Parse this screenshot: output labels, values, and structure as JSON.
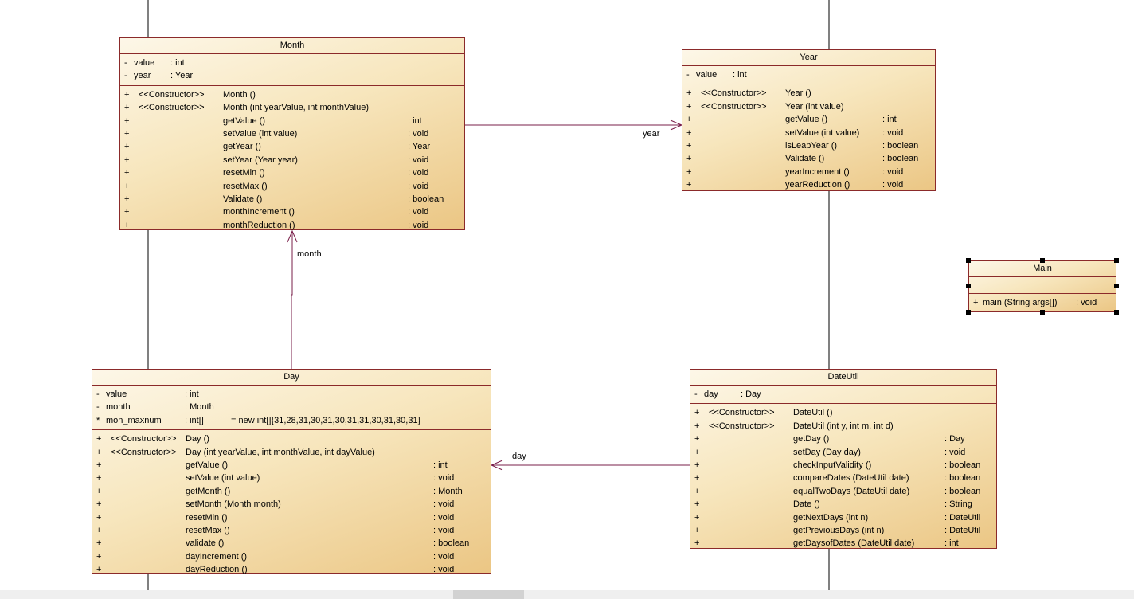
{
  "classes": {
    "month": {
      "name": "Month",
      "attributes": [
        {
          "vis": "-",
          "name": "value",
          "type": ": int",
          "init": ""
        },
        {
          "vis": "-",
          "name": "year",
          "type": ": Year",
          "init": ""
        }
      ],
      "operations": [
        {
          "vis": "+",
          "stereo": "<<Constructor>>",
          "sig": "Month ()",
          "ret": ""
        },
        {
          "vis": "+",
          "stereo": "<<Constructor>>",
          "sig": "Month (int yearValue, int monthValue)",
          "ret": ""
        },
        {
          "vis": "+",
          "stereo": "",
          "sig": "getValue ()",
          "ret": ": int"
        },
        {
          "vis": "+",
          "stereo": "",
          "sig": "setValue (int value)",
          "ret": ": void"
        },
        {
          "vis": "+",
          "stereo": "",
          "sig": "getYear ()",
          "ret": ": Year"
        },
        {
          "vis": "+",
          "stereo": "",
          "sig": "setYear (Year year)",
          "ret": ": void"
        },
        {
          "vis": "+",
          "stereo": "",
          "sig": "resetMin ()",
          "ret": ": void"
        },
        {
          "vis": "+",
          "stereo": "",
          "sig": "resetMax ()",
          "ret": ": void"
        },
        {
          "vis": "+",
          "stereo": "",
          "sig": "Validate ()",
          "ret": ": boolean"
        },
        {
          "vis": "+",
          "stereo": "",
          "sig": "monthIncrement ()",
          "ret": ": void"
        },
        {
          "vis": "+",
          "stereo": "",
          "sig": "monthReduction ()",
          "ret": ": void"
        }
      ]
    },
    "year": {
      "name": "Year",
      "attributes": [
        {
          "vis": "-",
          "name": "value",
          "type": ": int",
          "init": ""
        }
      ],
      "operations": [
        {
          "vis": "+",
          "stereo": "<<Constructor>>",
          "sig": "Year ()",
          "ret": ""
        },
        {
          "vis": "+",
          "stereo": "<<Constructor>>",
          "sig": "Year (int value)",
          "ret": ""
        },
        {
          "vis": "+",
          "stereo": "",
          "sig": "getValue ()",
          "ret": ": int"
        },
        {
          "vis": "+",
          "stereo": "",
          "sig": "setValue (int value)",
          "ret": ": void"
        },
        {
          "vis": "+",
          "stereo": "",
          "sig": "isLeapYear ()",
          "ret": ": boolean"
        },
        {
          "vis": "+",
          "stereo": "",
          "sig": "Validate ()",
          "ret": ": boolean"
        },
        {
          "vis": "+",
          "stereo": "",
          "sig": "yearIncrement ()",
          "ret": ": void"
        },
        {
          "vis": "+",
          "stereo": "",
          "sig": "yearReduction ()",
          "ret": ": void"
        }
      ]
    },
    "main": {
      "name": "Main",
      "attributes": [],
      "operations": [
        {
          "vis": "+",
          "stereo": "",
          "sig": "main (String args[])",
          "ret": ": void"
        }
      ]
    },
    "day": {
      "name": "Day",
      "attributes": [
        {
          "vis": "-",
          "name": "value",
          "type": ": int",
          "init": ""
        },
        {
          "vis": "-",
          "name": "month",
          "type": ": Month",
          "init": ""
        },
        {
          "vis": "*",
          "name": "mon_maxnum",
          "type": ": int[]",
          "init": "= new int[]{31,28,31,30,31,30,31,31,30,31,30,31}"
        }
      ],
      "operations": [
        {
          "vis": "+",
          "stereo": "<<Constructor>>",
          "sig": "Day ()",
          "ret": ""
        },
        {
          "vis": "+",
          "stereo": "<<Constructor>>",
          "sig": "Day (int yearValue, int monthValue, int dayValue)",
          "ret": ""
        },
        {
          "vis": "+",
          "stereo": "",
          "sig": "getValue ()",
          "ret": ": int"
        },
        {
          "vis": "+",
          "stereo": "",
          "sig": "setValue (int value)",
          "ret": ": void"
        },
        {
          "vis": "+",
          "stereo": "",
          "sig": "getMonth ()",
          "ret": ": Month"
        },
        {
          "vis": "+",
          "stereo": "",
          "sig": "setMonth (Month month)",
          "ret": ": void"
        },
        {
          "vis": "+",
          "stereo": "",
          "sig": "resetMin ()",
          "ret": ": void"
        },
        {
          "vis": "+",
          "stereo": "",
          "sig": "resetMax ()",
          "ret": ": void"
        },
        {
          "vis": "+",
          "stereo": "",
          "sig": "validate ()",
          "ret": ": boolean"
        },
        {
          "vis": "+",
          "stereo": "",
          "sig": "dayIncrement ()",
          "ret": ": void"
        },
        {
          "vis": "+",
          "stereo": "",
          "sig": "dayReduction ()",
          "ret": ": void"
        }
      ]
    },
    "dateutil": {
      "name": "DateUtil",
      "attributes": [
        {
          "vis": "-",
          "name": "day",
          "type": ": Day",
          "init": ""
        }
      ],
      "operations": [
        {
          "vis": "+",
          "stereo": "<<Constructor>>",
          "sig": "DateUtil ()",
          "ret": ""
        },
        {
          "vis": "+",
          "stereo": "<<Constructor>>",
          "sig": "DateUtil (int y, int m, int d)",
          "ret": ""
        },
        {
          "vis": "+",
          "stereo": "",
          "sig": "getDay ()",
          "ret": ": Day"
        },
        {
          "vis": "+",
          "stereo": "",
          "sig": "setDay (Day day)",
          "ret": ": void"
        },
        {
          "vis": "+",
          "stereo": "",
          "sig": "checkInputValidity ()",
          "ret": ": boolean"
        },
        {
          "vis": "+",
          "stereo": "",
          "sig": "compareDates (DateUtil date)",
          "ret": ": boolean"
        },
        {
          "vis": "+",
          "stereo": "",
          "sig": "equalTwoDays (DateUtil date)",
          "ret": ": boolean"
        },
        {
          "vis": "+",
          "stereo": "",
          "sig": "Date ()",
          "ret": ": String"
        },
        {
          "vis": "+",
          "stereo": "",
          "sig": "getNextDays (int n)",
          "ret": ": DateUtil"
        },
        {
          "vis": "+",
          "stereo": "",
          "sig": "getPreviousDays (int n)",
          "ret": ": DateUtil"
        },
        {
          "vis": "+",
          "stereo": "",
          "sig": "getDaysofDates (DateUtil date)",
          "ret": ": int"
        }
      ]
    }
  },
  "associations": {
    "month_year": "year",
    "day_month": "month",
    "dateutil_day": "day"
  },
  "colors": {
    "border": "#8b2a2a",
    "association": "#7a1f4a"
  }
}
